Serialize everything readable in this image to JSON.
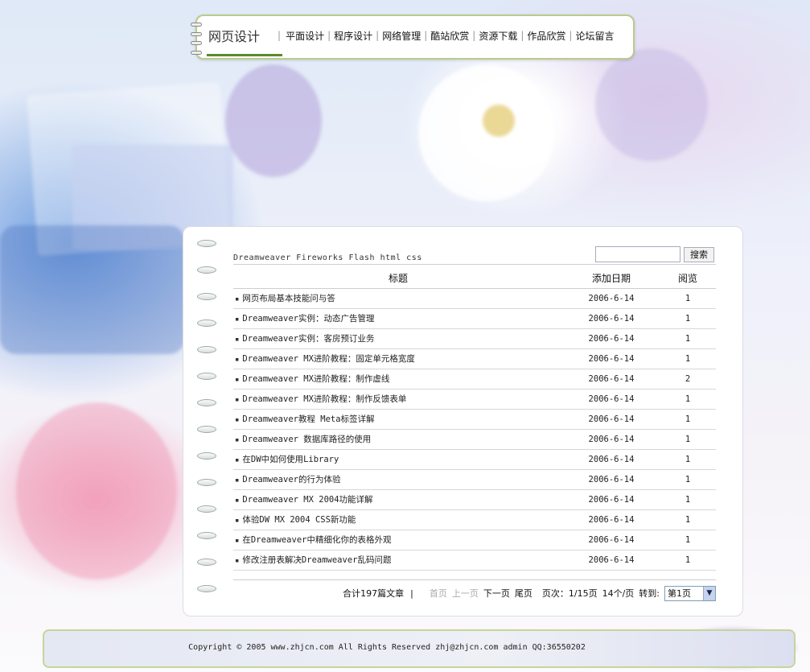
{
  "nav": {
    "home": "网页设计",
    "items": [
      "平面设计",
      "程序设计",
      "网络管理",
      "酷站欣赏",
      "资源下载",
      "作品欣赏",
      "论坛留言"
    ]
  },
  "tags": "Dreamweaver Fireworks Flash html css",
  "search": {
    "button": "搜索",
    "value": ""
  },
  "table": {
    "headers": [
      "标题",
      "添加日期",
      "阅览"
    ],
    "rows": [
      {
        "title": "网页布局基本技能问与答",
        "date": "2006-6-14",
        "views": "1"
      },
      {
        "title": "Dreamweaver实例：动态广告管理",
        "date": "2006-6-14",
        "views": "1"
      },
      {
        "title": "Dreamweaver实例：客房预订业务",
        "date": "2006-6-14",
        "views": "1"
      },
      {
        "title": "Dreamweaver MX进阶教程：固定单元格宽度",
        "date": "2006-6-14",
        "views": "1"
      },
      {
        "title": "Dreamweaver MX进阶教程：制作虚线",
        "date": "2006-6-14",
        "views": "2"
      },
      {
        "title": "Dreamweaver MX进阶教程：制作反馈表单",
        "date": "2006-6-14",
        "views": "1"
      },
      {
        "title": "Dreamweaver教程 Meta标签详解",
        "date": "2006-6-14",
        "views": "1"
      },
      {
        "title": "Dreamweaver 数据库路径的使用",
        "date": "2006-6-14",
        "views": "1"
      },
      {
        "title": "在DW中如何使用Library",
        "date": "2006-6-14",
        "views": "1"
      },
      {
        "title": "Dreamweaver的行为体验",
        "date": "2006-6-14",
        "views": "1"
      },
      {
        "title": "Dreamweaver MX 2004功能详解",
        "date": "2006-6-14",
        "views": "1"
      },
      {
        "title": "体验DW MX 2004 CSS新功能",
        "date": "2006-6-14",
        "views": "1"
      },
      {
        "title": "在Dreamweaver中精细化你的表格外观",
        "date": "2006-6-14",
        "views": "1"
      },
      {
        "title": "修改注册表解决Dreamweaver乱码问题",
        "date": "2006-6-14",
        "views": "1"
      }
    ]
  },
  "pager": {
    "total": "合计197篇文章",
    "sep": "|",
    "first": "首页",
    "prev": "上一页",
    "next": "下一页",
    "last": "尾页",
    "page_info": "页次：1/15页",
    "per_page": "14个/页",
    "goto_label": "转到:",
    "select_value": "第1页"
  },
  "footer": "Copyright © 2005 www.zhjcn.com All Rights Reserved zhj@zhjcn.com admin QQ:36550202",
  "colors": {
    "nav_border": "#b9cc8a",
    "nav_active": "#5a8a2a",
    "footer_border": "#c7d59a"
  }
}
